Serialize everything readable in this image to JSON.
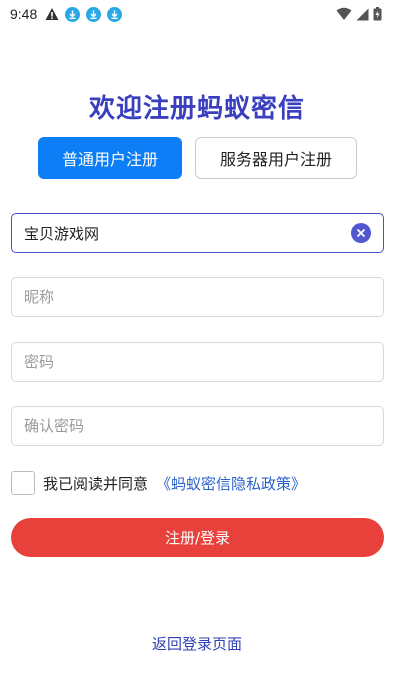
{
  "status_bar": {
    "time": "9:48",
    "icons": [
      "warning-icon",
      "download-icon",
      "download-icon",
      "download-icon",
      "wifi-icon",
      "signal-icon",
      "battery-icon"
    ]
  },
  "title": "欢迎注册蚂蚁密信",
  "tabs": {
    "normal": "普通用户注册",
    "server": "服务器用户注册",
    "active": "normal"
  },
  "form": {
    "site": {
      "value": "宝贝游戏网",
      "placeholder": ""
    },
    "nickname": {
      "value": "",
      "placeholder": "昵称"
    },
    "password": {
      "value": "",
      "placeholder": "密码"
    },
    "confirm_password": {
      "value": "",
      "placeholder": "确认密码"
    }
  },
  "agreement": {
    "text": "我已阅读并同意",
    "link": "《蚂蚁密信隐私政策》",
    "checked": false
  },
  "submit_label": "注册/登录",
  "back_link": "返回登录页面",
  "colors": {
    "title": "#3a3fbf",
    "tab_active": "#0d7ef5",
    "submit": "#e8403a",
    "link": "#2a62c9",
    "download_icon": "#29a8e8"
  }
}
